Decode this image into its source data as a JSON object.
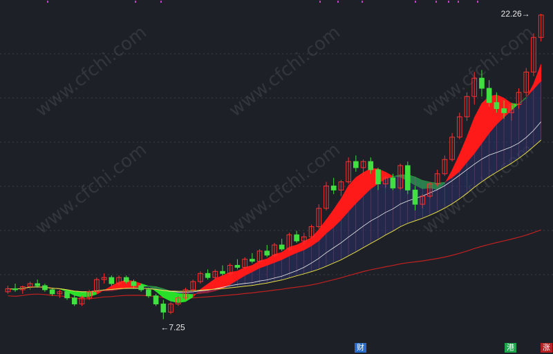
{
  "chart_data": {
    "type": "candlestick",
    "price_range": [
      7.25,
      22.26
    ],
    "annotations": {
      "low_label": "7.25",
      "high_label": "22.26"
    },
    "bottom_tags": [
      {
        "name": "财",
        "color": "#2a6ac8"
      },
      {
        "name": "港",
        "color": "#1fa54a"
      },
      {
        "name": "涨",
        "color": "#b22222"
      }
    ],
    "watermark": "www.cfchi.com",
    "candles": [
      [
        8.6,
        8.9,
        8.5,
        8.75
      ],
      [
        8.75,
        9.0,
        8.6,
        8.7
      ],
      [
        8.7,
        8.9,
        8.5,
        8.85
      ],
      [
        8.85,
        9.1,
        8.7,
        9.0
      ],
      [
        9.0,
        9.2,
        8.8,
        8.9
      ],
      [
        8.9,
        9.0,
        8.6,
        8.7
      ],
      [
        8.7,
        8.8,
        8.4,
        8.5
      ],
      [
        8.5,
        8.7,
        8.3,
        8.6
      ],
      [
        8.6,
        8.7,
        8.2,
        8.3
      ],
      [
        8.3,
        8.5,
        7.9,
        8.0
      ],
      [
        8.0,
        8.4,
        7.9,
        8.3
      ],
      [
        8.3,
        8.7,
        8.2,
        8.6
      ],
      [
        8.6,
        9.3,
        8.5,
        9.2
      ],
      [
        9.2,
        9.5,
        9.0,
        9.3
      ],
      [
        9.3,
        9.4,
        8.9,
        9.0
      ],
      [
        9.0,
        9.4,
        8.9,
        9.3
      ],
      [
        9.3,
        9.4,
        9.0,
        9.1
      ],
      [
        9.1,
        9.2,
        8.8,
        8.9
      ],
      [
        8.9,
        9.0,
        8.6,
        8.7
      ],
      [
        8.7,
        8.8,
        8.3,
        8.4
      ],
      [
        8.4,
        8.5,
        7.9,
        8.0
      ],
      [
        8.0,
        8.2,
        7.25,
        7.6
      ],
      [
        7.6,
        8.1,
        7.5,
        8.0
      ],
      [
        8.0,
        8.4,
        7.9,
        8.3
      ],
      [
        8.3,
        8.8,
        8.2,
        8.7
      ],
      [
        8.7,
        9.2,
        8.6,
        9.1
      ],
      [
        9.1,
        9.6,
        9.0,
        9.5
      ],
      [
        9.5,
        9.7,
        9.2,
        9.3
      ],
      [
        9.3,
        9.7,
        9.2,
        9.6
      ],
      [
        9.6,
        9.9,
        9.4,
        9.5
      ],
      [
        9.5,
        10.0,
        9.4,
        9.9
      ],
      [
        9.9,
        10.2,
        9.7,
        9.8
      ],
      [
        9.8,
        10.3,
        9.7,
        10.2
      ],
      [
        10.2,
        10.5,
        10.0,
        10.1
      ],
      [
        10.1,
        10.7,
        10.0,
        10.6
      ],
      [
        10.6,
        10.9,
        10.3,
        10.4
      ],
      [
        10.4,
        11.0,
        10.3,
        10.9
      ],
      [
        10.9,
        11.2,
        10.6,
        10.7
      ],
      [
        10.7,
        11.5,
        10.6,
        11.4
      ],
      [
        11.4,
        11.6,
        11.0,
        11.1
      ],
      [
        11.1,
        11.5,
        10.9,
        11.3
      ],
      [
        11.3,
        11.9,
        11.2,
        11.8
      ],
      [
        11.8,
        12.9,
        11.7,
        12.7
      ],
      [
        12.7,
        14.0,
        12.6,
        13.8
      ],
      [
        13.8,
        14.2,
        13.4,
        13.6
      ],
      [
        13.6,
        14.1,
        13.3,
        14.0
      ],
      [
        14.0,
        15.2,
        13.9,
        15.0
      ],
      [
        15.0,
        15.3,
        14.5,
        14.7
      ],
      [
        14.7,
        15.1,
        14.3,
        15.0
      ],
      [
        15.0,
        15.2,
        14.4,
        14.6
      ],
      [
        14.6,
        14.7,
        13.6,
        13.9
      ],
      [
        13.9,
        14.3,
        13.7,
        14.2
      ],
      [
        14.2,
        14.4,
        13.6,
        13.7
      ],
      [
        13.7,
        14.9,
        13.6,
        14.8
      ],
      [
        14.8,
        15.0,
        13.4,
        13.6
      ],
      [
        13.6,
        13.8,
        12.6,
        12.9
      ],
      [
        12.9,
        13.4,
        12.7,
        13.3
      ],
      [
        13.3,
        14.0,
        13.2,
        13.9
      ],
      [
        13.9,
        14.6,
        13.8,
        14.4
      ],
      [
        14.4,
        15.3,
        14.3,
        15.1
      ],
      [
        15.1,
        16.4,
        15.0,
        16.2
      ],
      [
        16.2,
        17.4,
        16.1,
        17.2
      ],
      [
        17.2,
        18.4,
        17.0,
        18.2
      ],
      [
        18.2,
        19.4,
        17.8,
        19.1
      ],
      [
        19.1,
        19.5,
        18.2,
        18.6
      ],
      [
        18.6,
        19.0,
        17.7,
        17.9
      ],
      [
        17.9,
        18.4,
        17.4,
        17.6
      ],
      [
        17.6,
        18.0,
        17.1,
        17.4
      ],
      [
        17.4,
        17.9,
        17.0,
        17.8
      ],
      [
        17.8,
        18.6,
        17.6,
        18.4
      ],
      [
        18.4,
        19.6,
        18.2,
        19.4
      ],
      [
        19.4,
        21.3,
        19.2,
        21.1
      ],
      [
        21.1,
        22.26,
        20.9,
        22.2
      ]
    ]
  }
}
